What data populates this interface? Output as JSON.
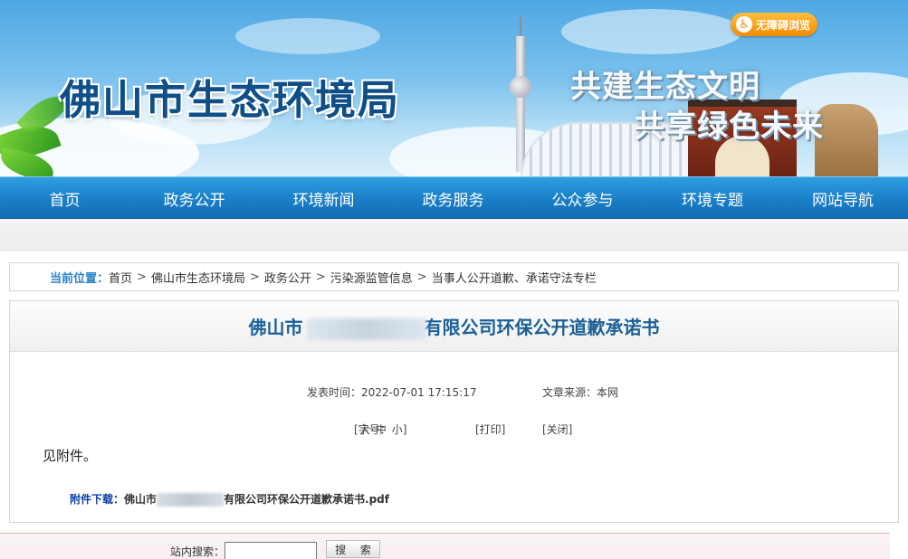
{
  "header": {
    "site_title": "佛山市生态环境局",
    "slogan_line1": "共建生态文明",
    "slogan_line2": "共享绿色未来",
    "accessibility": {
      "label": "无障碍浏览",
      "icon": "wheelchair-icon"
    }
  },
  "nav": {
    "items": [
      {
        "label": "首页"
      },
      {
        "label": "政务公开"
      },
      {
        "label": "环境新闻"
      },
      {
        "label": "政务服务"
      },
      {
        "label": "公众参与"
      },
      {
        "label": "环境专题"
      },
      {
        "label": "网站导航"
      }
    ]
  },
  "breadcrumb": {
    "label": "当前位置：",
    "items": [
      "首页",
      "佛山市生态环境局",
      "政务公开",
      "污染源监管信息",
      "当事人公开道歉、承诺守法专栏"
    ],
    "separator": ">"
  },
  "article": {
    "title_prefix": "佛山市",
    "title_suffix": "有限公司环保公开道歉承诺书",
    "publish_label": "发表时间：",
    "publish_time": "2022-07-01 17:15:17",
    "source_label": "文章来源：",
    "source": "本网",
    "font_size_label": "[字号：",
    "font_large": "大",
    "font_medium": "中",
    "font_small": "小",
    "font_size_end": "]",
    "print": "[打印]",
    "close": "[关闭]",
    "body": "见附件。",
    "attachment_label": "附件下载：",
    "attachment_prefix": "佛山市",
    "attachment_suffix": "有限公司环保公开道歉承诺书.pdf"
  },
  "footer": {
    "search_label": "站内搜索：",
    "search_value": "",
    "search_button": "搜 索"
  }
}
